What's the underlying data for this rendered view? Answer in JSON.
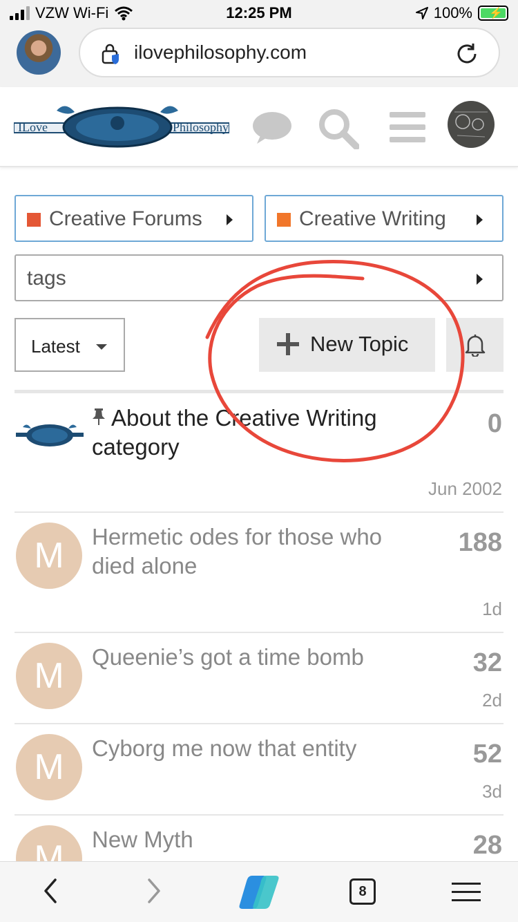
{
  "status_bar": {
    "carrier": "VZW Wi-Fi",
    "time": "12:25 PM",
    "battery": "100%"
  },
  "browser": {
    "url": "ilovephilosophy.com",
    "tabs_count": "8"
  },
  "breadcrumbs": {
    "parent_category": "Creative Forums",
    "parent_color": "#e45735",
    "category": "Creative Writing",
    "category_color": "#f1762a",
    "tags": "tags"
  },
  "controls": {
    "sort": "Latest",
    "new_topic": "New Topic"
  },
  "topics": [
    {
      "title": "About the Creative Writing category",
      "replies": "0",
      "activity": "Jun 2002",
      "pinned": true
    },
    {
      "title": "Hermetic odes for those who died alone",
      "replies": "188",
      "activity": "1d",
      "avatar_letter": "M"
    },
    {
      "title": "Queenie’s got a time bomb",
      "replies": "32",
      "activity": "2d",
      "avatar_letter": "M"
    },
    {
      "title": "Cyborg me now that entity",
      "replies": "52",
      "activity": "3d",
      "avatar_letter": "M"
    },
    {
      "title": "New Myth",
      "replies": "28",
      "avatar_letter": "M"
    }
  ],
  "colors": {
    "accent_border": "#6ea8d6",
    "annotation": "#e8473a",
    "avatar_bg": "#e6cbb2"
  }
}
